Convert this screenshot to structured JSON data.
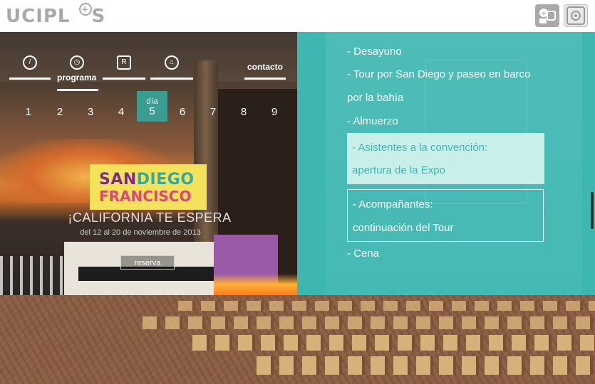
{
  "header": {
    "logo_text": "UCIPL",
    "logo_tail": "S",
    "user_button_icon": "user-add-icon",
    "settings_button_icon": "settings-icon"
  },
  "nav": {
    "items": [
      {
        "icon": "compass-icon",
        "label": ""
      },
      {
        "icon": "clock-icon",
        "label": "programa"
      },
      {
        "icon": "r-icon",
        "label": ""
      },
      {
        "icon": "home-icon",
        "label": ""
      },
      {
        "icon": "",
        "label": "contacto"
      }
    ]
  },
  "days": {
    "label": "día",
    "numbers": [
      "1",
      "2",
      "3",
      "4",
      "5",
      "6",
      "7",
      "8",
      "9"
    ],
    "active": "5"
  },
  "hero": {
    "brand_line1_a": "SAN",
    "brand_line1_b": "DIEGO",
    "brand_line2": "FRANCISCO",
    "tagline": "¡CALIFORNIA TE ESPERA",
    "dateline": "del 12 al 20 de noviembre de 2013",
    "reserve_label": "reserva"
  },
  "schedule": {
    "items": [
      "- Desayuno",
      "- Tour por San Diego y paseo en barco",
      "por la bahía",
      "- Almuerzo"
    ],
    "box_attendees": [
      "- Asistentes a la convención:",
      "apertura de la Expo"
    ],
    "box_companions": [
      "- Acompañantes:",
      "continuación del Tour"
    ],
    "last": "- Cena"
  },
  "colors": {
    "teal": "#3fb7b1",
    "logo_gray": "#a9a9a9"
  }
}
